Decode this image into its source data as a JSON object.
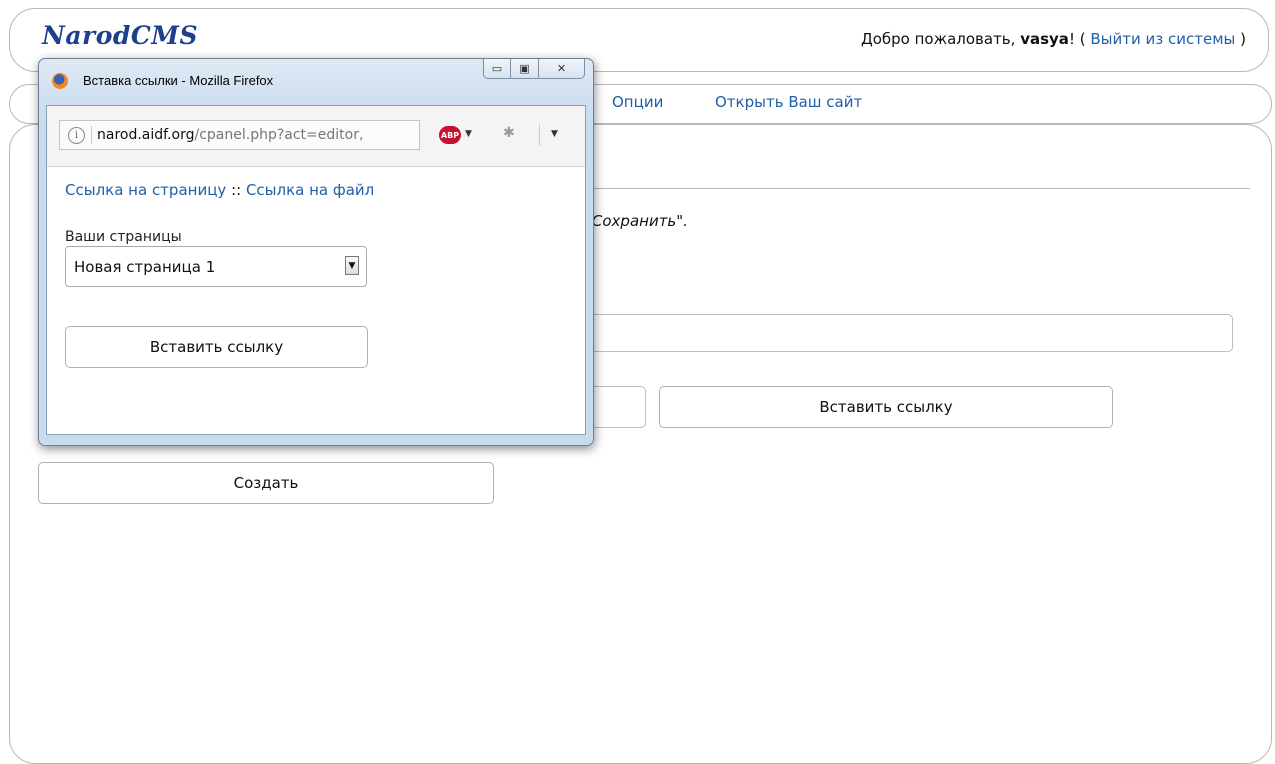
{
  "header": {
    "logo": "NarodCMS",
    "welcome_prefix": "Добро пожаловать,",
    "username": "vasya",
    "welcome_suffix": "! (",
    "logout_label": "Выйти из системы",
    "close_paren": ")"
  },
  "nav": {
    "items": [
      {
        "label": "Опции"
      },
      {
        "label": "Открыть Ваш сайт"
      }
    ]
  },
  "main": {
    "save_note": "\"Сохранить\".",
    "insert_link_button": "Вставить ссылку",
    "create_button": "Создать"
  },
  "popup": {
    "title": "Вставка ссылки - Mozilla Firefox",
    "url_host": "narod.aidf.org",
    "url_path": "/cpanel.php?act=editor,",
    "abp_label": "ABP",
    "link_page": "Ссылка на страницу",
    "link_sep": "::",
    "link_file": "Ссылка на файл",
    "pages_label": "Ваши страницы",
    "selected_page": "Новая страница 1",
    "insert_button": "Вставить ссылку"
  }
}
